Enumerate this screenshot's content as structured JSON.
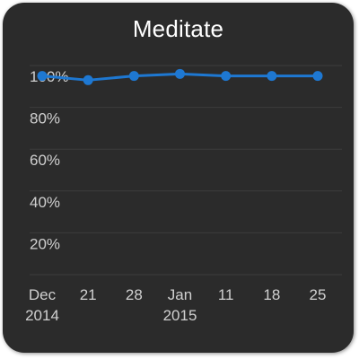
{
  "widget": {
    "title": "Meditate"
  },
  "colors": {
    "card_background": "#2b2b2b",
    "line": "#1e78d2",
    "grid": "#3c3c3c",
    "title_text": "#ffffff",
    "axis_text": "#d0d0d0"
  },
  "chart_data": {
    "type": "line",
    "title": "Meditate",
    "xlabel": "",
    "ylabel": "",
    "ylim": [
      0,
      100
    ],
    "y_ticks": [
      "100%",
      "80%",
      "60%",
      "40%",
      "20%"
    ],
    "y_tick_values": [
      100,
      80,
      60,
      40,
      20
    ],
    "x_ticks": [
      {
        "line1": "Dec",
        "line2": "2014"
      },
      {
        "line1": "21",
        "line2": ""
      },
      {
        "line1": "28",
        "line2": ""
      },
      {
        "line1": "Jan",
        "line2": "2015"
      },
      {
        "line1": "11",
        "line2": ""
      },
      {
        "line1": "18",
        "line2": ""
      },
      {
        "line1": "25",
        "line2": ""
      }
    ],
    "series": [
      {
        "values": [
          95,
          93,
          95,
          96,
          95,
          95,
          95
        ]
      }
    ],
    "grid": true,
    "legend": "none"
  }
}
